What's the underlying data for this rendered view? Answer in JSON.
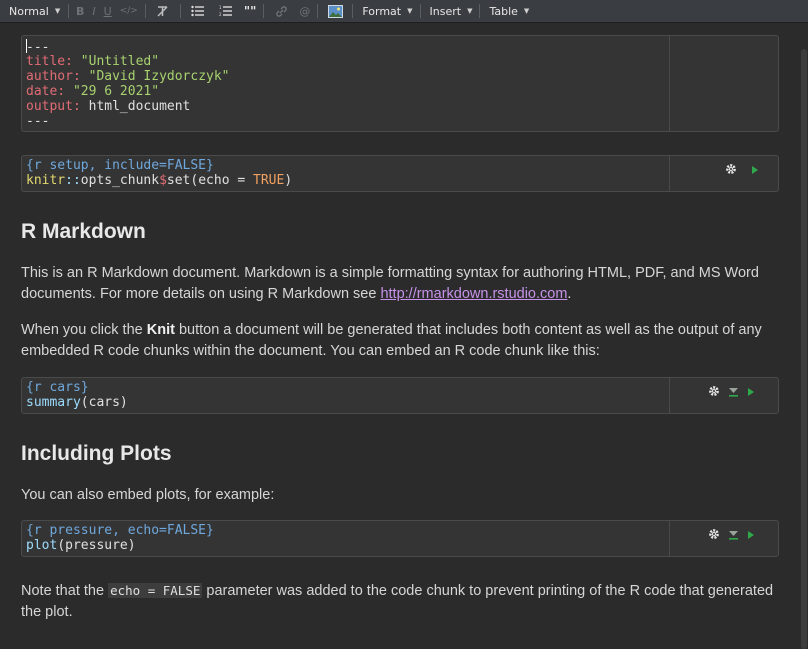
{
  "toolbar": {
    "style_select": "Normal",
    "bold": "B",
    "italic": "I",
    "underline": "U",
    "code": "</>",
    "blockquote": "\"\"",
    "link_at": "@",
    "format": "Format",
    "insert": "Insert",
    "table": "Table"
  },
  "yaml": {
    "l1": "---",
    "title_key": "title:",
    "title_val": "\"Untitled\"",
    "author_key": "author:",
    "author_val": "\"David Izydorczyk\"",
    "date_key": "date:",
    "date_val": "\"29 6 2021\"",
    "output_key": "output:",
    "output_val": "html_document",
    "l6": "---"
  },
  "chunk_setup": {
    "header": "{r setup, include=FALSE}",
    "pkg": "knitr",
    "ns": "::",
    "fn": "opts_chunk",
    "dollar": "$",
    "method": "set",
    "open": "(",
    "arg": "echo",
    "eq": " = ",
    "val": "TRUE",
    "close": ")"
  },
  "h_rmarkdown": "R Markdown",
  "p1": {
    "text": "This is an R Markdown document. Markdown is a simple formatting syntax for authoring HTML, PDF, and MS Word documents. For more details on using R Markdown see ",
    "link": "http://rmarkdown.rstudio.com",
    "end": "."
  },
  "p2": {
    "before": "When you click the ",
    "bold": "Knit",
    "after": " button a document will be generated that includes both content as well as the output of any embedded R code chunks within the document. You can embed an R code chunk like this:"
  },
  "chunk_cars": {
    "header": "{r cars}",
    "fn": "summary",
    "args": "(cars)"
  },
  "h_plots": "Including Plots",
  "p3": "You can also embed plots, for example:",
  "chunk_pressure": {
    "header": "{r pressure, echo=FALSE}",
    "fn": "plot",
    "args": "(pressure)"
  },
  "p4": {
    "before": "Note that the ",
    "code": "echo = FALSE",
    "after": " parameter was added to the code chunk to prevent printing of the R code that generated the plot."
  },
  "colors": {
    "background": "#2b2b2b",
    "toolbar": "#3a3d41",
    "link": "#c792ea",
    "run_arrow": "#2ea84a"
  }
}
